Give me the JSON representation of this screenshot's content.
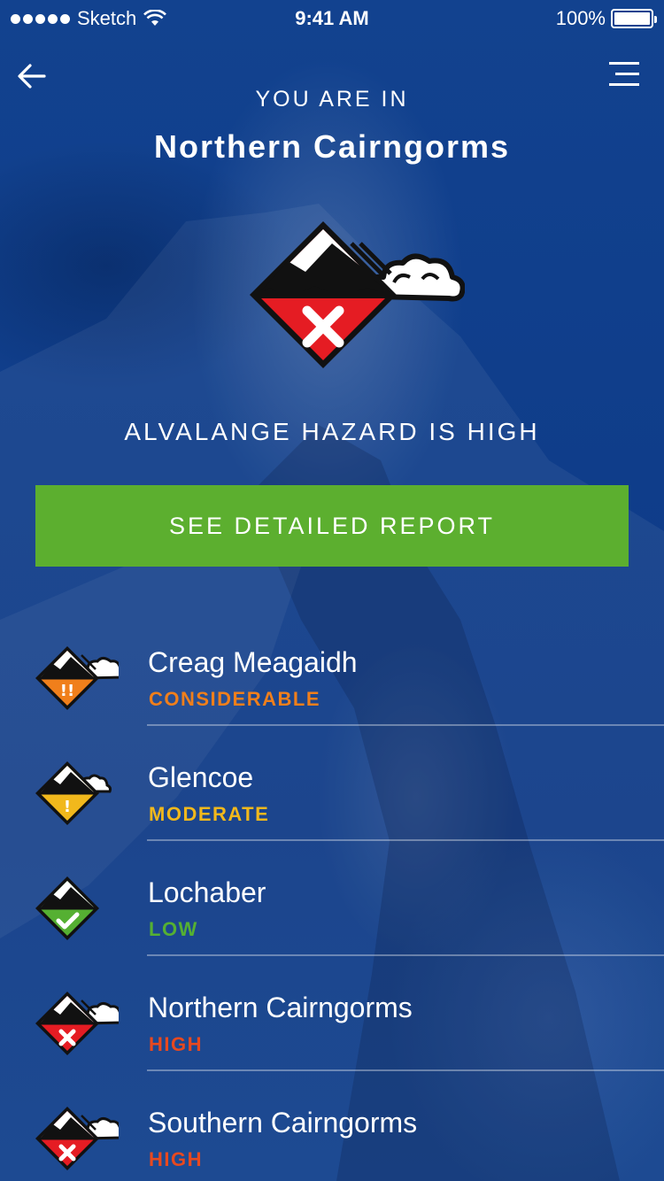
{
  "status_bar": {
    "carrier": "Sketch",
    "time": "9:41 AM",
    "battery": "100%"
  },
  "header": {
    "back_icon": "arrow-left-icon",
    "menu_icon": "hamburger-menu-icon",
    "subtitle": "YOU ARE IN",
    "title": "Northern Cairngorms"
  },
  "current": {
    "hazard_text": "ALVALANGE HAZARD IS HIGH",
    "icon": "avalanche-high-icon"
  },
  "report_button": {
    "label": "SEE DETAILED REPORT",
    "color": "#5caf2f"
  },
  "regions": [
    {
      "name": "Creag Meagaidh",
      "level": "CONSIDERABLE",
      "color": "#f07f1b",
      "icon": "avalanche-considerable-icon"
    },
    {
      "name": "Glencoe",
      "level": "MODERATE",
      "color": "#f1b81c",
      "icon": "avalanche-moderate-icon"
    },
    {
      "name": "Lochaber",
      "level": "LOW",
      "color": "#55b032",
      "icon": "avalanche-low-icon"
    },
    {
      "name": "Northern Cairngorms",
      "level": "HIGH",
      "color": "#e8491f",
      "icon": "avalanche-high-icon"
    },
    {
      "name": "Southern Cairngorms",
      "level": "HIGH",
      "color": "#e8491f",
      "icon": "avalanche-high-icon"
    }
  ]
}
